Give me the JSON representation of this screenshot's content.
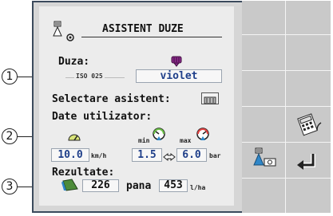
{
  "header": {
    "title": "ASISTENT DUZE"
  },
  "nozzle": {
    "label": "Duza:",
    "standard": "ISO 025",
    "color_name": "violet",
    "color_hex": "#8e2a8e"
  },
  "assistant": {
    "label": "Selectare asistent:"
  },
  "user_data": {
    "label": "Date utilizator:",
    "speed_value": "10.0",
    "speed_unit": "km/h",
    "min_label": "min",
    "max_label": "max",
    "pressure_min": "1.5",
    "pressure_max": "6.0",
    "pressure_unit": "bar"
  },
  "results": {
    "label": "Rezultate:",
    "value1": "226",
    "separator": "pana",
    "value2": "453",
    "unit": "l/ha"
  },
  "callouts": [
    "1",
    "2",
    "3"
  ],
  "colors": {
    "border": "#3b4a5c",
    "panel": "#ececec",
    "softkey_bg": "#c9c9c9",
    "value_text": "#1f3f8a",
    "accent_blue": "#2f87c9"
  }
}
